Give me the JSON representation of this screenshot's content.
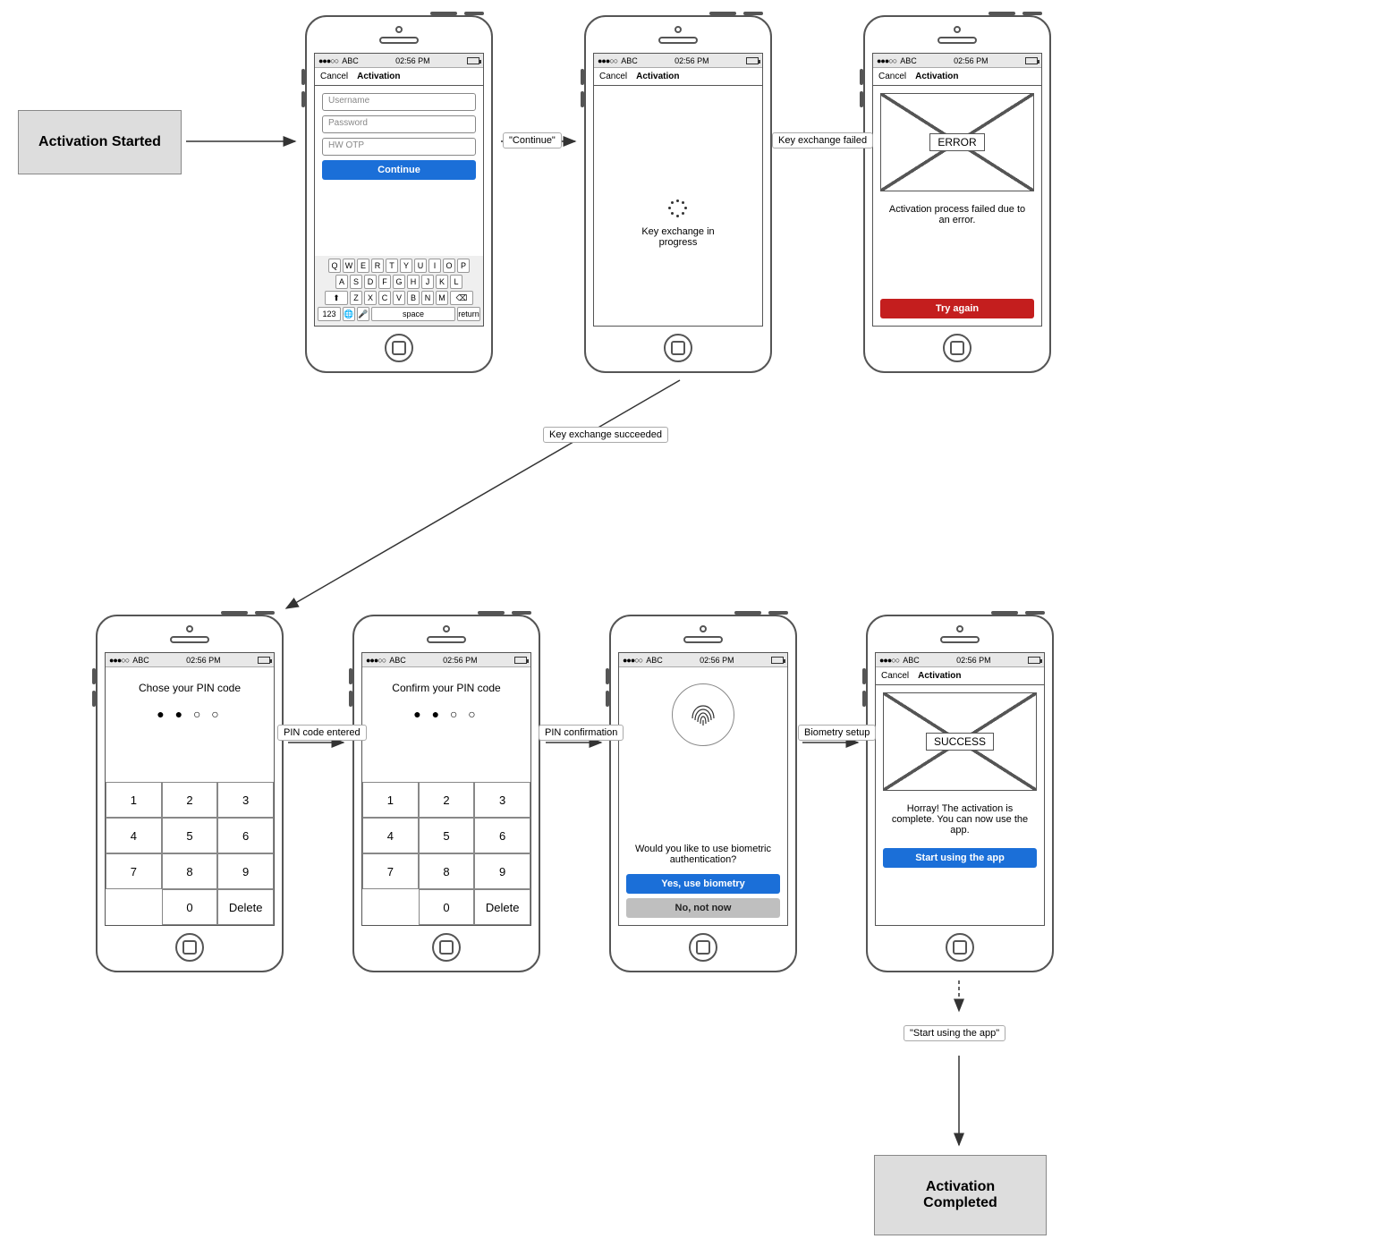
{
  "states": {
    "start": "Activation Started",
    "end": "Activation Completed"
  },
  "status": {
    "carrier": "ABC",
    "time": "02:56 PM",
    "signal": "●●●○○"
  },
  "nav": {
    "cancel": "Cancel",
    "title": "Activation"
  },
  "s1": {
    "username": "Username",
    "password": "Password",
    "otp": "HW OTP",
    "continue": "Continue",
    "krow1": [
      "Q",
      "W",
      "E",
      "R",
      "T",
      "Y",
      "U",
      "I",
      "O",
      "P"
    ],
    "krow2": [
      "A",
      "S",
      "D",
      "F",
      "G",
      "H",
      "J",
      "K",
      "L"
    ],
    "krow3": [
      "Z",
      "X",
      "C",
      "V",
      "B",
      "N",
      "M"
    ],
    "k123": "123",
    "kspace": "space",
    "kreturn": "return",
    "kshift": "⬆"
  },
  "s2": {
    "msg": "Key exchange in progress"
  },
  "s3": {
    "tag": "ERROR",
    "msg": "Activation process failed due to an error.",
    "btn": "Try again"
  },
  "s4": {
    "title": "Chose your PIN code",
    "digits": [
      "1",
      "2",
      "3",
      "4",
      "5",
      "6",
      "7",
      "8",
      "9",
      "",
      "0",
      "Delete"
    ]
  },
  "s5": {
    "title": "Confirm your PIN code",
    "digits": [
      "1",
      "2",
      "3",
      "4",
      "5",
      "6",
      "7",
      "8",
      "9",
      "",
      "0",
      "Delete"
    ]
  },
  "s6": {
    "msg": "Would you like to use biometric authentication?",
    "yes": "Yes, use biometry",
    "no": "No, not now"
  },
  "s7": {
    "tag": "SUCCESS",
    "msg": "Horray! The activation is complete. You can now use the app.",
    "btn": "Start using the app"
  },
  "labels": {
    "l1": "\"Continue\"",
    "l2": "Key exchange failed",
    "l3": "Key exchange succeeded",
    "l4": "PIN code entered",
    "l5": "PIN confirmation",
    "l6": "Biometry setup",
    "l7": "\"Start using the app\""
  },
  "pindots": "● ● ○ ○"
}
